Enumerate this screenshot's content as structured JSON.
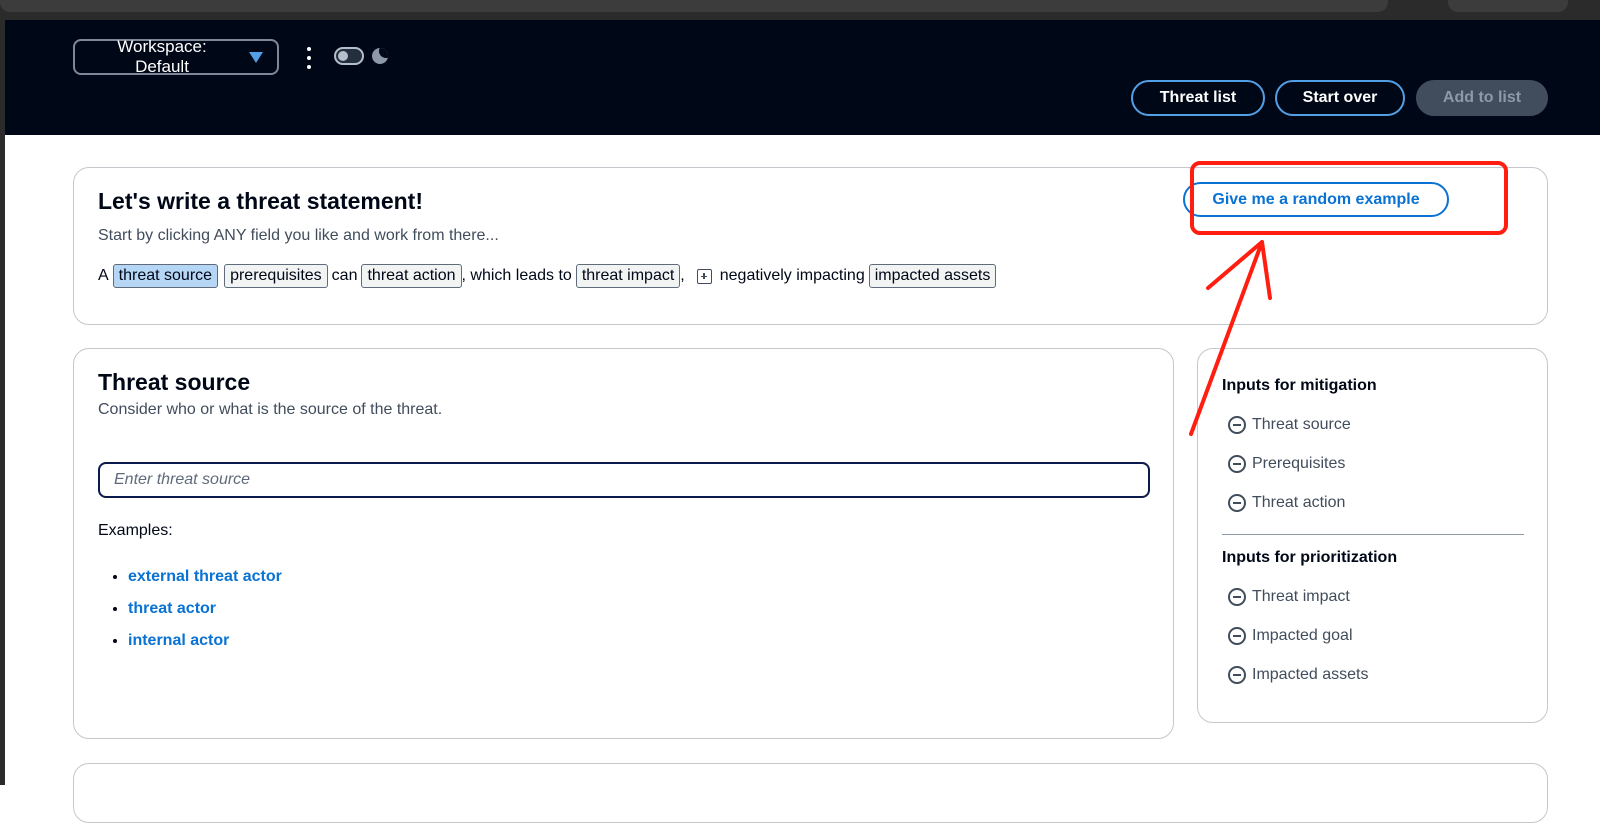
{
  "header": {
    "workspace_label": "Workspace: Default",
    "buttons": {
      "threat_list": "Threat list",
      "start_over": "Start over",
      "add_to_list": "Add to list"
    }
  },
  "intro": {
    "title": "Let's write a threat statement!",
    "subtitle": "Start by clicking ANY field you like and work from there...",
    "random_button": "Give me a random example",
    "sentence": {
      "prefix": "A",
      "threat_source": "threat source",
      "prerequisites": "prerequisites",
      "can": "can",
      "threat_action": "threat action",
      "which_leads_to": ", which leads to",
      "threat_impact": "threat impact",
      "comma": ",",
      "negatively_impacting": "negatively impacting",
      "impacted_assets": "impacted assets"
    }
  },
  "editor": {
    "title": "Threat source",
    "description": "Consider who or what is the source of the threat.",
    "input": {
      "value": "",
      "placeholder": "Enter threat source"
    },
    "examples_label": "Examples:",
    "examples": [
      "external threat actor",
      "threat actor",
      "internal actor"
    ]
  },
  "side_panel": {
    "mitigation_title": "Inputs for mitigation",
    "mitigation_items": [
      "Threat source",
      "Prerequisites",
      "Threat action"
    ],
    "prioritization_title": "Inputs for prioritization",
    "prioritization_items": [
      "Threat impact",
      "Impacted goal",
      "Impacted assets"
    ]
  },
  "colors": {
    "header_bg": "#000716",
    "accent": "#0972d3",
    "annotation": "#ff1e0f",
    "active_chip": "#b5d6f4"
  }
}
